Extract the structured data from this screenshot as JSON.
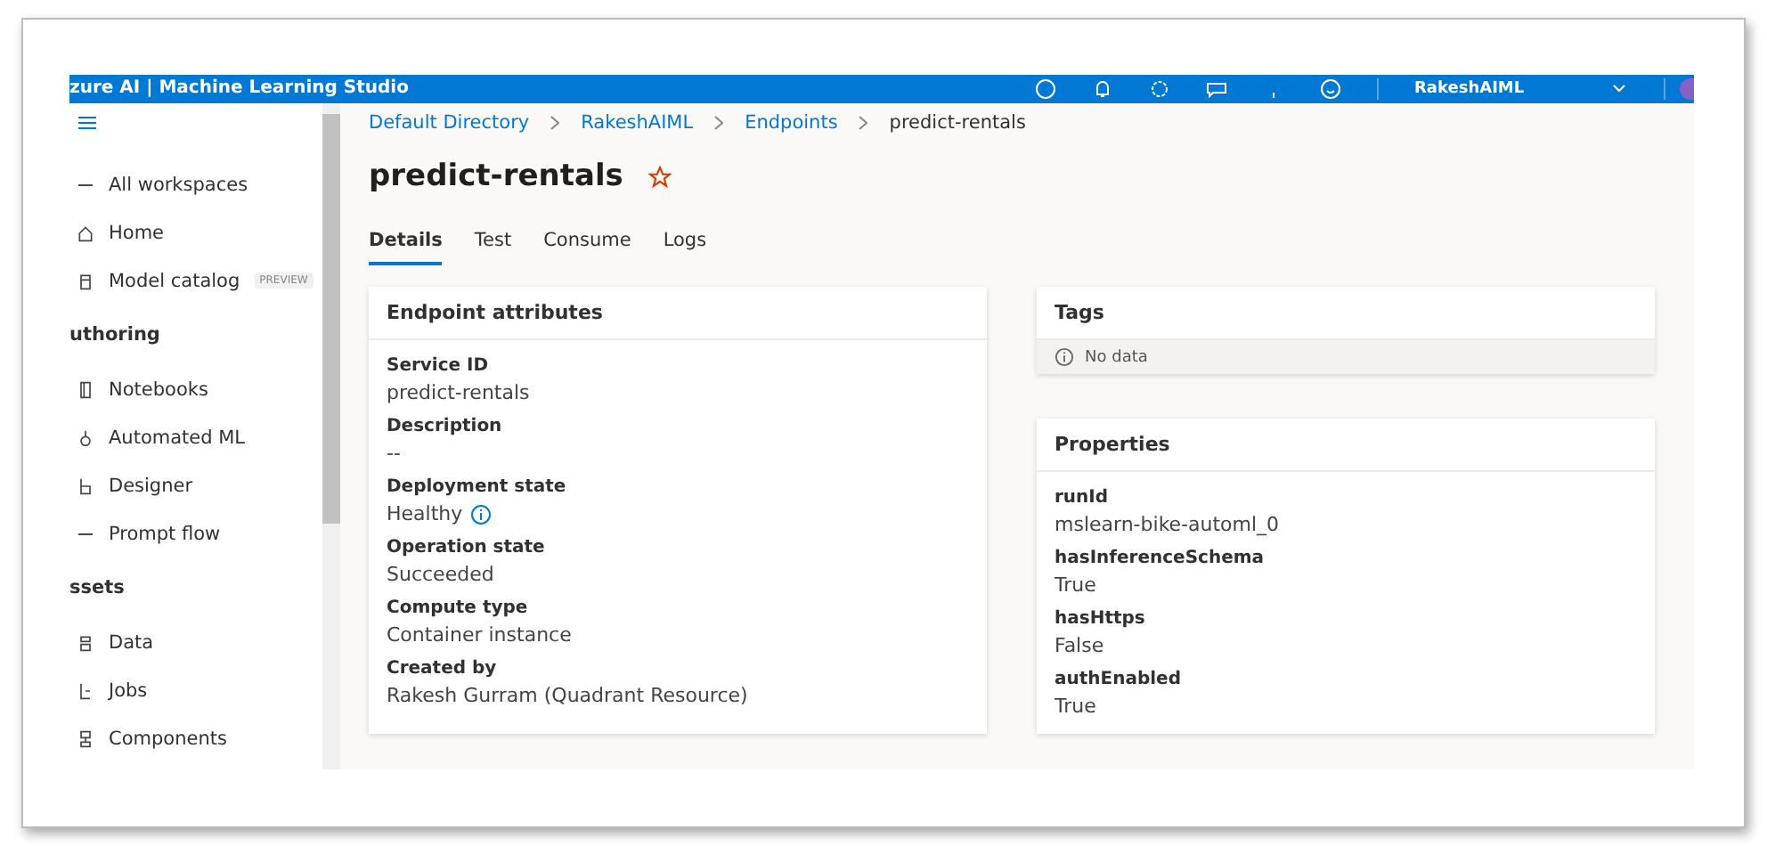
{
  "header": {
    "title": "zure AI | Machine Learning Studio",
    "account": "RakeshAIML"
  },
  "sidebar": {
    "items": [
      {
        "kind": "item",
        "label": "All workspaces"
      },
      {
        "kind": "item",
        "label": "Home"
      },
      {
        "kind": "item",
        "label": "Model catalog",
        "badge": "PREVIEW"
      },
      {
        "kind": "section",
        "label": "uthoring"
      },
      {
        "kind": "item",
        "label": "Notebooks"
      },
      {
        "kind": "item",
        "label": "Automated ML"
      },
      {
        "kind": "item",
        "label": "Designer"
      },
      {
        "kind": "item",
        "label": "Prompt flow"
      },
      {
        "kind": "section",
        "label": "ssets"
      },
      {
        "kind": "item",
        "label": "Data"
      },
      {
        "kind": "item",
        "label": "Jobs"
      },
      {
        "kind": "item",
        "label": "Components"
      }
    ]
  },
  "breadcrumb": [
    {
      "label": "Default Directory",
      "link": true
    },
    {
      "label": "RakeshAIML",
      "link": true
    },
    {
      "label": "Endpoints",
      "link": true
    },
    {
      "label": "predict-rentals",
      "link": false
    }
  ],
  "page_title": "predict-rentals",
  "favorite": false,
  "tabs": [
    {
      "label": "Details",
      "selected": true
    },
    {
      "label": "Test",
      "selected": false
    },
    {
      "label": "Consume",
      "selected": false
    },
    {
      "label": "Logs",
      "selected": false
    }
  ],
  "endpoint_attributes": {
    "title": "Endpoint attributes",
    "fields": [
      {
        "label": "Service ID",
        "value": "predict-rentals"
      },
      {
        "label": "Description",
        "value": "--"
      },
      {
        "label": "Deployment state",
        "value": "Healthy",
        "info": true
      },
      {
        "label": "Operation state",
        "value": "Succeeded"
      },
      {
        "label": "Compute type",
        "value": "Container instance"
      },
      {
        "label": "Created by",
        "value": "Rakesh Gurram (Quadrant Resource)"
      }
    ]
  },
  "tags": {
    "title": "Tags",
    "empty_text": "No data"
  },
  "properties": {
    "title": "Properties",
    "fields": [
      {
        "label": "runId",
        "value": "mslearn-bike-automl_0"
      },
      {
        "label": "hasInferenceSchema",
        "value": "True"
      },
      {
        "label": "hasHttps",
        "value": "False"
      },
      {
        "label": "authEnabled",
        "value": "True"
      }
    ]
  }
}
